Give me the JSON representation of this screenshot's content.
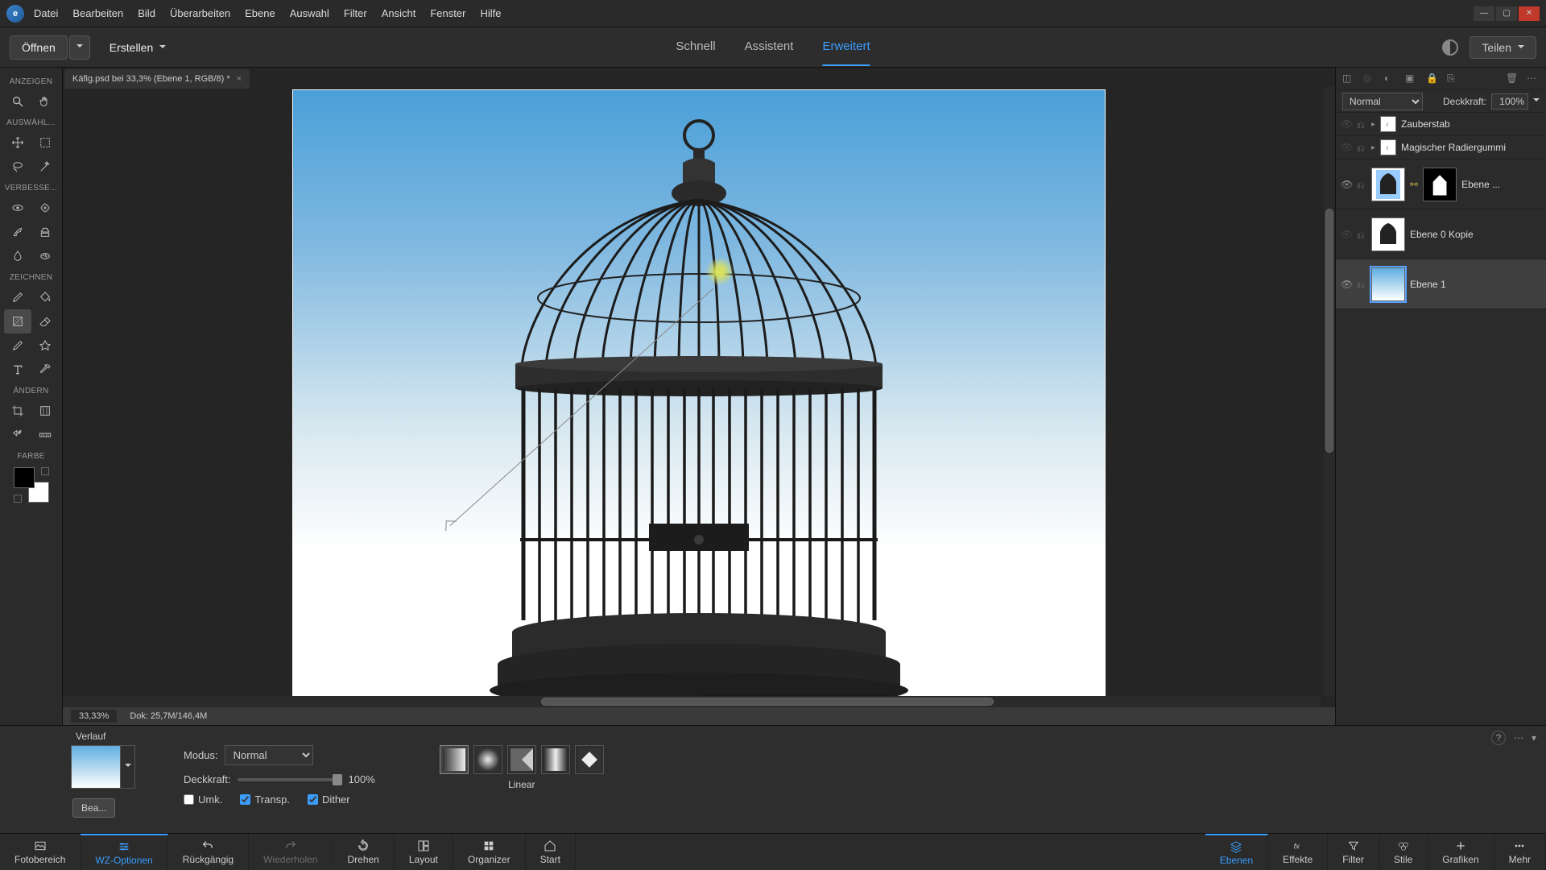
{
  "menubar": [
    "Datei",
    "Bearbeiten",
    "Bild",
    "Überarbeiten",
    "Ebene",
    "Auswahl",
    "Filter",
    "Ansicht",
    "Fenster",
    "Hilfe"
  ],
  "actionbar": {
    "open": "Öffnen",
    "create": "Erstellen",
    "modes": {
      "quick": "Schnell",
      "assistant": "Assistent",
      "advanced": "Erweitert"
    },
    "share": "Teilen"
  },
  "document": {
    "tab_title": "Käfig.psd bei 33,3% (Ebene 1, RGB/8) *",
    "zoom": "33,33%",
    "doc_size": "Dok: 25,7M/146,4M"
  },
  "toolbox": {
    "sections": {
      "view": "ANZEIGEN",
      "select": "AUSWÄHL...",
      "enhance": "VERBESSE...",
      "draw": "ZEICHNEN",
      "modify": "ÄNDERN",
      "color": "FARBE"
    }
  },
  "layers_panel": {
    "blend_mode": "Normal",
    "opacity_label": "Deckkraft:",
    "opacity_value": "100%",
    "layers": [
      {
        "name": "Zauberstab",
        "visible": false,
        "type": "adjustment"
      },
      {
        "name": "Magischer Radiergummi",
        "visible": false,
        "type": "adjustment"
      },
      {
        "name": "Ebene ...",
        "visible": true,
        "type": "image-with-mask"
      },
      {
        "name": "Ebene 0 Kopie",
        "visible": false,
        "type": "image"
      },
      {
        "name": "Ebene 1",
        "visible": true,
        "type": "gradient",
        "selected": true
      }
    ]
  },
  "options": {
    "tool_name": "Verlauf",
    "mode_label": "Modus:",
    "mode_value": "Normal",
    "opacity_label": "Deckkraft:",
    "opacity_value": "100%",
    "edit_button": "Bea...",
    "reverse": {
      "label": "Umk.",
      "checked": false
    },
    "transparency": {
      "label": "Transp.",
      "checked": true
    },
    "dither": {
      "label": "Dither",
      "checked": true
    },
    "type_label": "Linear"
  },
  "bottombar_left": [
    {
      "key": "photo-bin",
      "label": "Fotobereich"
    },
    {
      "key": "tool-options",
      "label": "WZ-Optionen",
      "active": true
    },
    {
      "key": "undo",
      "label": "Rückgängig"
    },
    {
      "key": "redo",
      "label": "Wiederholen"
    },
    {
      "key": "rotate",
      "label": "Drehen"
    },
    {
      "key": "layout",
      "label": "Layout"
    },
    {
      "key": "organizer",
      "label": "Organizer"
    },
    {
      "key": "start",
      "label": "Start"
    }
  ],
  "bottombar_right": [
    {
      "key": "layers",
      "label": "Ebenen",
      "active": true
    },
    {
      "key": "effects",
      "label": "Effekte"
    },
    {
      "key": "filters",
      "label": "Filter"
    },
    {
      "key": "styles",
      "label": "Stile"
    },
    {
      "key": "graphics",
      "label": "Grafiken"
    },
    {
      "key": "more",
      "label": "Mehr"
    }
  ]
}
